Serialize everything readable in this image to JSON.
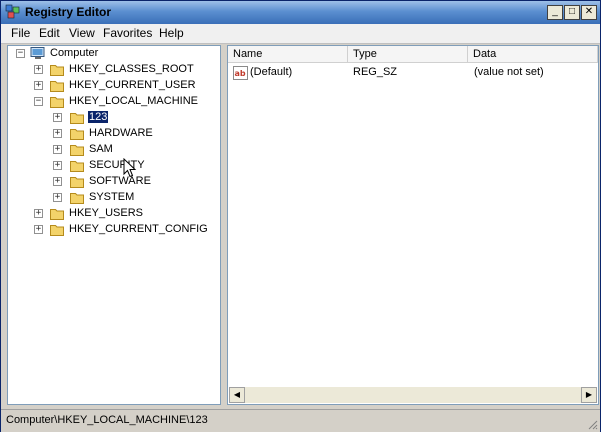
{
  "window": {
    "title": "Registry Editor",
    "controls": {
      "minimize": "_",
      "maximize": "□",
      "close": "✕"
    }
  },
  "menu": [
    "File",
    "Edit",
    "View",
    "Favorites",
    "Help"
  ],
  "tree": {
    "root": "Computer",
    "hives": [
      {
        "label": "HKEY_CLASSES_ROOT",
        "expander": "+"
      },
      {
        "label": "HKEY_CURRENT_USER",
        "expander": "+"
      },
      {
        "label": "HKEY_LOCAL_MACHINE",
        "expander": "−"
      },
      {
        "label": "HKEY_USERS",
        "expander": "+"
      },
      {
        "label": "HKEY_CURRENT_CONFIG",
        "expander": "+"
      }
    ],
    "hklm_children": [
      {
        "label": "123",
        "expander": "+"
      },
      {
        "label": "HARDWARE",
        "expander": "+"
      },
      {
        "label": "SAM",
        "expander": "+"
      },
      {
        "label": "SECURITY",
        "expander": "+"
      },
      {
        "label": "SOFTWARE",
        "expander": "+"
      },
      {
        "label": "SYSTEM",
        "expander": "+"
      }
    ],
    "root_expander": "−"
  },
  "values_pane": {
    "columns": [
      "Name",
      "Type",
      "Data"
    ],
    "rows": [
      {
        "name": "(Default)",
        "type": "REG_SZ",
        "data": "(value not set)",
        "icon": "ab-string-icon"
      }
    ]
  },
  "status_bar": {
    "path": "Computer\\HKEY_LOCAL_MACHINE\\123"
  },
  "icons": {
    "scroll_left": "◀",
    "scroll_right": "▶"
  },
  "colors": {
    "selection": "#0a246a",
    "title_gradient_top": "#9ec0e8",
    "folder": "#f3d36a"
  }
}
